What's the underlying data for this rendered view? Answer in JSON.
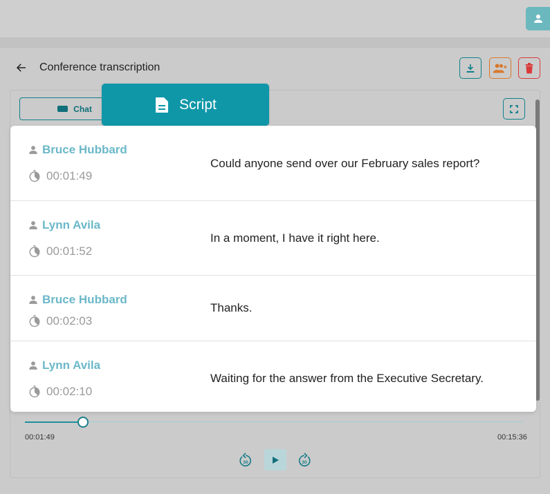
{
  "header": {
    "title": "Conference transcription",
    "icons": {
      "back": "arrow-left-icon",
      "download": "download-icon",
      "users": "add-users-icon",
      "delete": "trash-icon",
      "avatar": "person-icon"
    }
  },
  "tabs": {
    "chat_label": "Chat",
    "script_label": "Script",
    "active": "Script"
  },
  "transcript": [
    {
      "speaker": "Bruce Hubbard",
      "time": "00:01:49",
      "text": "Could anyone send over our February sales report?"
    },
    {
      "speaker": "Lynn Avila",
      "time": "00:01:52",
      "text": "In a moment, I have it right here."
    },
    {
      "speaker": "Bruce Hubbard",
      "time": "00:02:03",
      "text": "Thanks."
    },
    {
      "speaker": "Lynn Avila",
      "time": "00:02:10",
      "text": "Waiting for the answer from the Executive Secretary."
    }
  ],
  "player": {
    "current": "00:01:49",
    "total": "00:15:36",
    "progress_fraction": 0.116,
    "skip_back_label": "30",
    "skip_forward_label": "30"
  },
  "colors": {
    "accent": "#0f97a8",
    "speaker": "#6bb8c8",
    "download": "#0f7f8c",
    "users": "#d9772a",
    "delete": "#d93a3a"
  }
}
